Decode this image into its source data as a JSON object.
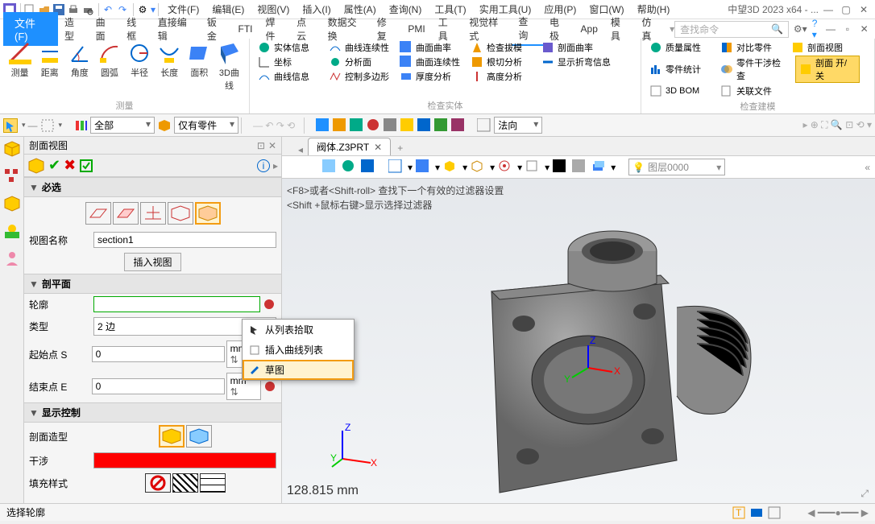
{
  "app_title": "中望3D 2023 x64 - ...",
  "menubar": {
    "file_btn": "文件(F)",
    "items": [
      "文件(F)",
      "编辑(E)",
      "视图(V)",
      "插入(I)",
      "属性(A)",
      "查询(N)",
      "工具(T)",
      "实用工具(U)",
      "应用(P)",
      "窗口(W)",
      "帮助(H)"
    ]
  },
  "ribbon_tabs": [
    "造型",
    "曲面",
    "线框",
    "直接编辑",
    "钣金",
    "FTI",
    "焊件",
    "点云",
    "数据交换",
    "修复",
    "PMI",
    "工具",
    "视觉样式",
    "查询",
    "电极",
    "App",
    "模具",
    "仿真"
  ],
  "search_placeholder": "查找命令",
  "ribbon": {
    "measure_group": [
      "测量",
      "距离",
      "角度",
      "圆弧",
      "半径",
      "长度",
      "面积",
      "3D曲线"
    ],
    "measure_label": "测量",
    "entity_group": {
      "rows": [
        [
          "实体信息",
          "曲线连续性",
          "曲面曲率",
          "检查拔模",
          "剖面曲率"
        ],
        [
          "坐标",
          "分析面",
          "曲面连续性",
          "根切分析",
          "显示折弯信息"
        ],
        [
          "曲线信息",
          "控制多边形",
          "厚度分析",
          "高度分析",
          ""
        ]
      ],
      "label": "检查实体"
    },
    "model_group": {
      "rows": [
        [
          "质量属性",
          "对比零件",
          "剖面视图"
        ],
        [
          "零件统计",
          "零件干涉检查",
          "剖面 开/关"
        ],
        [
          "3D BOM",
          "关联文件",
          ""
        ]
      ],
      "label": "检查建模"
    }
  },
  "qat2": {
    "combo1": "全部",
    "combo2": "仅有零件",
    "combo3": "法向"
  },
  "panel": {
    "title": "剖面视图",
    "sections": {
      "required": "必选",
      "view_name_label": "视图名称",
      "view_name_value": "section1",
      "insert_view_btn": "插入视图",
      "cut_plane": "剖平面",
      "profile_label": "轮廓",
      "profile_value": "",
      "type_label": "类型",
      "type_value": "2 边",
      "start_label": "起始点 S",
      "start_value": "0",
      "end_label": "结束点 E",
      "end_value": "0",
      "unit": "mm",
      "display": "显示控制",
      "section_shape_label": "剖面造型",
      "interference_label": "干涉",
      "fill_style_label": "填充样式"
    }
  },
  "context_menu": {
    "pick_from_list": "从列表拾取",
    "insert_curve_list": "插入曲线列表",
    "sketch": "草图"
  },
  "tab": {
    "name": "阀体.Z3PRT"
  },
  "hints": {
    "line1": "<F8>或者<Shift-roll> 查找下一个有效的过滤器设置",
    "line2": "<Shift +鼠标右键>显示选择过滤器"
  },
  "layer_combo": "图层0000",
  "dim_readout": "128.815 mm",
  "status": "选择轮廓"
}
